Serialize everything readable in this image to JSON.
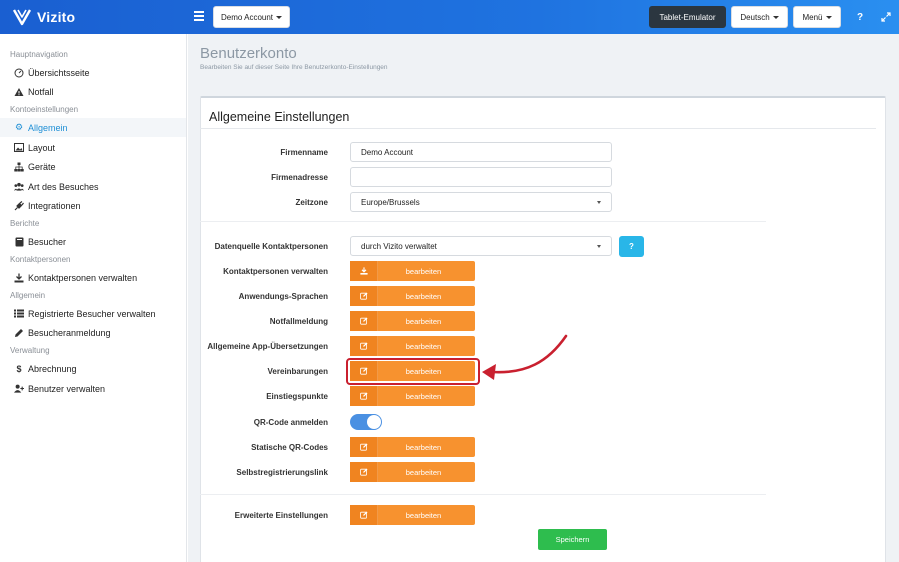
{
  "app": {
    "name": "Vizito"
  },
  "topbar": {
    "account_label": "Demo Account",
    "tablet_label": "Tablet-Emulator",
    "language_label": "Deutsch",
    "menu_label": "Menü",
    "help_icon": "?",
    "expand_icon": "expand-icon"
  },
  "sidebar": {
    "sections": [
      {
        "title": "Hauptnavigation",
        "items": [
          {
            "label": "Übersichtsseite",
            "icon": "gauge-icon"
          },
          {
            "label": "Notfall",
            "icon": "warning-icon"
          }
        ]
      },
      {
        "title": "Kontoeinstellungen",
        "items": [
          {
            "label": "Allgemein",
            "icon": "gear-icon",
            "active": true
          },
          {
            "label": "Layout",
            "icon": "image-icon"
          },
          {
            "label": "Geräte",
            "icon": "sitemap-icon"
          },
          {
            "label": "Art des Besuches",
            "icon": "users-icon"
          },
          {
            "label": "Integrationen",
            "icon": "plug-icon"
          }
        ]
      },
      {
        "title": "Berichte",
        "items": [
          {
            "label": "Besucher",
            "icon": "book-icon"
          }
        ]
      },
      {
        "title": "Kontaktpersonen",
        "items": [
          {
            "label": "Kontaktpersonen verwalten",
            "icon": "download-icon"
          }
        ]
      },
      {
        "title": "Allgemein",
        "items": [
          {
            "label": "Registrierte Besucher verwalten",
            "icon": "list-icon"
          },
          {
            "label": "Besucheranmeldung",
            "icon": "pencil-icon"
          }
        ]
      },
      {
        "title": "Verwaltung",
        "items": [
          {
            "label": "Abrechnung",
            "icon": "dollar-icon"
          },
          {
            "label": "Benutzer verwalten",
            "icon": "user-plus-icon"
          }
        ]
      }
    ]
  },
  "page": {
    "title": "Benutzerkonto",
    "subtitle": "Bearbeiten Sie auf dieser Seite Ihre Benutzerkonto-Einstellungen"
  },
  "card": {
    "title": "Allgemeine Einstellungen",
    "fields": {
      "firmenname": {
        "label": "Firmenname",
        "value": "Demo Account"
      },
      "firmenadresse": {
        "label": "Firmenadresse",
        "value": ""
      },
      "zeitzone": {
        "label": "Zeitzone",
        "value": "Europe/Brussels"
      },
      "datenquelle": {
        "label": "Datenquelle Kontaktpersonen",
        "value": "durch Vizito verwaltet",
        "help": "?"
      }
    },
    "edit_rows": [
      {
        "label": "Kontaktpersonen verwalten",
        "button": "bearbeiten",
        "icon": "download-icon"
      },
      {
        "label": "Anwendungs-Sprachen",
        "button": "bearbeiten",
        "icon": "edit-icon"
      },
      {
        "label": "Notfallmeldung",
        "button": "bearbeiten",
        "icon": "edit-icon"
      },
      {
        "label": "Allgemeine App-Übersetzungen",
        "button": "bearbeiten",
        "icon": "edit-icon"
      },
      {
        "label": "Vereinbarungen",
        "button": "bearbeiten",
        "icon": "edit-icon"
      },
      {
        "label": "Einstiegspunkte",
        "button": "bearbeiten",
        "icon": "edit-icon"
      }
    ],
    "qr_toggle": {
      "label": "QR-Code anmelden",
      "on": true
    },
    "edit_rows_2": [
      {
        "label": "Statische QR-Codes",
        "button": "bearbeiten",
        "icon": "edit-icon"
      },
      {
        "label": "Selbstregistrierungslink",
        "button": "bearbeiten",
        "icon": "edit-icon"
      }
    ],
    "advanced": {
      "label": "Erweiterte Einstellungen",
      "button": "bearbeiten",
      "icon": "edit-icon"
    },
    "save_label": "Speichern"
  },
  "colors": {
    "topbar": "#1f73e0",
    "accent_orange": "#f7922f",
    "save_green": "#2ebd4e",
    "help_blue": "#29b6e8",
    "highlight_red": "#c9202f",
    "active_blue": "#1e8fd6"
  }
}
